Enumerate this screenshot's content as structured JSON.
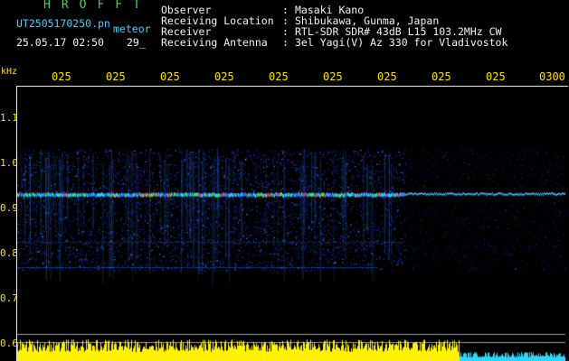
{
  "header": {
    "title": "HROFFT",
    "filename": "UT2505170250.pn",
    "file_suffix": "meteor",
    "datetime": "25.05.17 02:50",
    "count": "29_"
  },
  "info": [
    {
      "label": "Observer",
      "sep": ":",
      "value": "Masaki Kano"
    },
    {
      "label": "Receiving Location",
      "sep": ":",
      "value": "Shibukawa, Gunma, Japan"
    },
    {
      "label": "Receiver",
      "sep": ":",
      "value": "RTL-SDR SDR# 43dB L15 103.2MHz CW"
    },
    {
      "label": "Receiving Antenna",
      "sep": ":",
      "value": "3el Yagi(V) Az 330 for Vladivostok"
    }
  ],
  "y_unit": "kHz",
  "time_ticks": [
    "025",
    "025",
    "025",
    "025",
    "025",
    "025",
    "025",
    "025",
    "025",
    "0300"
  ],
  "y_ticks": [
    "1.1",
    "1.0",
    "0.9",
    "0.8",
    "0.7",
    "0.6"
  ],
  "colors": {
    "background": "#000000",
    "title": "#3ddc3d",
    "filename": "#3fd0ff",
    "labels": "#f2f2f2",
    "axis": "#ffe000",
    "signal_low": "#0a2aa0",
    "signal_mid": "#1e8cff",
    "signal_high": "#ff3030",
    "trace": "#fff200",
    "trace_end": "#2ad8ff"
  }
}
